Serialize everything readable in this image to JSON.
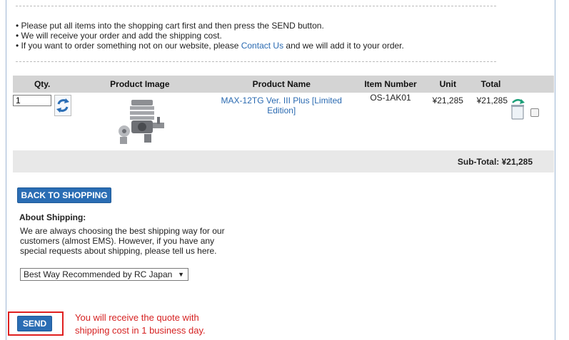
{
  "notes": {
    "line1": "• Please put all items into the shopping cart first and then press the SEND button.",
    "line2": "• We will receive your order and add the shipping cost.",
    "line3_pre": "• If you want to order something not on our website, please ",
    "line3_link": "Contact Us",
    "line3_post": " and we will add it to your order."
  },
  "cart": {
    "headers": {
      "qty": "Qty.",
      "image": "Product Image",
      "name": "Product Name",
      "item_number": "Item Number",
      "unit": "Unit",
      "total": "Total"
    },
    "items": [
      {
        "qty": "1",
        "name": "MAX-12TG Ver. III Plus [Limited Edition]",
        "item_number": "OS-1AK01",
        "unit": "¥21,285",
        "total": "¥21,285"
      }
    ],
    "subtotal": "Sub-Total: ¥21,285"
  },
  "buttons": {
    "back": "BACK TO SHOPPING",
    "send": "SEND"
  },
  "shipping": {
    "heading": "About Shipping:",
    "text": "We are always choosing the best shipping way for our customers (almost EMS). However, if you have any special requests about shipping, please tell us here.",
    "selected": "Best Way Recommended by RC Japan"
  },
  "annotation": {
    "line1": "You will receive the quote with",
    "line2": "shipping cost in 1 business day."
  },
  "icons": {
    "refresh": "refresh-icon",
    "trash": "trash-icon",
    "dropdown": "chevron-down-icon"
  },
  "colors": {
    "accent": "#2a6db4",
    "link": "#2a6ab1",
    "highlight": "#e02020"
  }
}
